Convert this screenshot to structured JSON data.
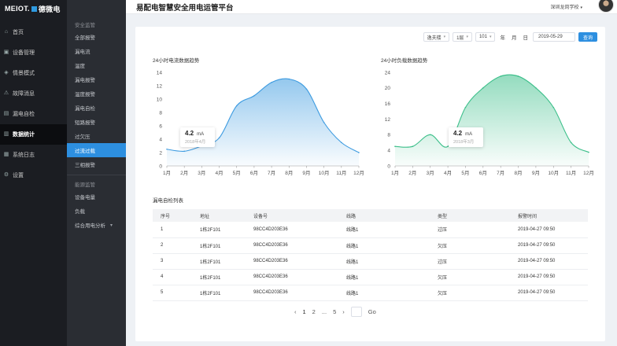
{
  "brand": {
    "latin": "MEIOT.",
    "cn": "德微电"
  },
  "header": {
    "title": "易配电智慧安全用电运管平台",
    "school": "深圳龙岗学校",
    "dropdown": "▾"
  },
  "nav": [
    {
      "label": "首页",
      "icon": "home-icon",
      "glyph": "⌂"
    },
    {
      "label": "设备管理",
      "icon": "device-icon",
      "glyph": "▣"
    },
    {
      "label": "情景模式",
      "icon": "scene-icon",
      "glyph": "◈"
    },
    {
      "label": "故障消息",
      "icon": "alert-icon",
      "glyph": "⚠"
    },
    {
      "label": "漏电自检",
      "icon": "leak-icon",
      "glyph": "▤"
    },
    {
      "label": "数据统计",
      "icon": "chart-icon",
      "glyph": "▥"
    },
    {
      "label": "系统日志",
      "icon": "log-icon",
      "glyph": "▦"
    },
    {
      "label": "设置",
      "icon": "gear-icon",
      "glyph": "⚙"
    }
  ],
  "subnav": {
    "group1": "安全监管",
    "items1": [
      "全部报警",
      "漏电流",
      "温度",
      "漏电报警",
      "温度报警",
      "漏电自检",
      "短路报警",
      "过欠压",
      "过流过载",
      "三相报警"
    ],
    "group2": "能源监管",
    "items2": [
      "设备电量",
      "负载",
      "综合用电分析"
    ],
    "chevron": "▾"
  },
  "filters": {
    "building": "逸夫楼",
    "floor": "1层",
    "room": "101",
    "seg_year": "年",
    "seg_month": "月",
    "seg_day": "日",
    "date": "2019-05-29",
    "query": "查询"
  },
  "colors": {
    "accent": "#2d8fe0",
    "chart1": "#3d9be0",
    "chart2": "#3cbf8a"
  },
  "chart_data": [
    {
      "type": "area",
      "title": "24小时电流数据趋势",
      "categories": [
        "1月",
        "2月",
        "3月",
        "4月",
        "5月",
        "6月",
        "7月",
        "8月",
        "9月",
        "10月",
        "11月",
        "12月"
      ],
      "values": [
        2.5,
        2.2,
        3.0,
        4.2,
        9.0,
        10.5,
        12.5,
        13.0,
        11.5,
        6.5,
        3.5,
        2.0
      ],
      "ylim": [
        0,
        14
      ],
      "yticks": [
        0,
        2,
        4,
        6,
        8,
        10,
        12,
        14
      ],
      "tooltip": {
        "value": "4.2",
        "unit": "mA",
        "date": "2018年4月"
      }
    },
    {
      "type": "area",
      "title": "24小时负载数据趋势",
      "categories": [
        "1月",
        "2月",
        "3月",
        "4月",
        "5月",
        "6月",
        "7月",
        "8月",
        "9月",
        "10月",
        "11月",
        "12月"
      ],
      "values": [
        5,
        5,
        8,
        5,
        15,
        20,
        23,
        23,
        20,
        15,
        6,
        3.5
      ],
      "ylim": [
        0,
        24
      ],
      "yticks": [
        0,
        4,
        8,
        12,
        16,
        20,
        24
      ],
      "tooltip": {
        "value": "4.2",
        "unit": "mA",
        "date": "2018年3月"
      }
    }
  ],
  "table": {
    "title": "漏电自检列表",
    "headers": [
      "序号",
      "地址",
      "设备号",
      "线路",
      "类型",
      "报警时间"
    ],
    "rows": [
      [
        "1",
        "1栋2F101",
        "98CC4D203E36",
        "线路1",
        "过压",
        "2019-04-27 09:50"
      ],
      [
        "2",
        "1栋2F101",
        "98CC4D203E36",
        "线路1",
        "欠压",
        "2019-04-27 09:50"
      ],
      [
        "3",
        "1栋2F101",
        "98CC4D203E36",
        "线路1",
        "过压",
        "2019-04-27 09:50"
      ],
      [
        "4",
        "1栋2F101",
        "98CC4D203E36",
        "线路1",
        "欠压",
        "2019-04-27 09:50"
      ],
      [
        "5",
        "1栋2F101",
        "98CC4D203E36",
        "线路1",
        "欠压",
        "2019-04-27 09:50"
      ]
    ]
  },
  "pagination": {
    "prev": "‹",
    "page1": "1",
    "page2": "2",
    "ellipsis": "...",
    "page5": "5",
    "next": "›",
    "go": "Go"
  }
}
